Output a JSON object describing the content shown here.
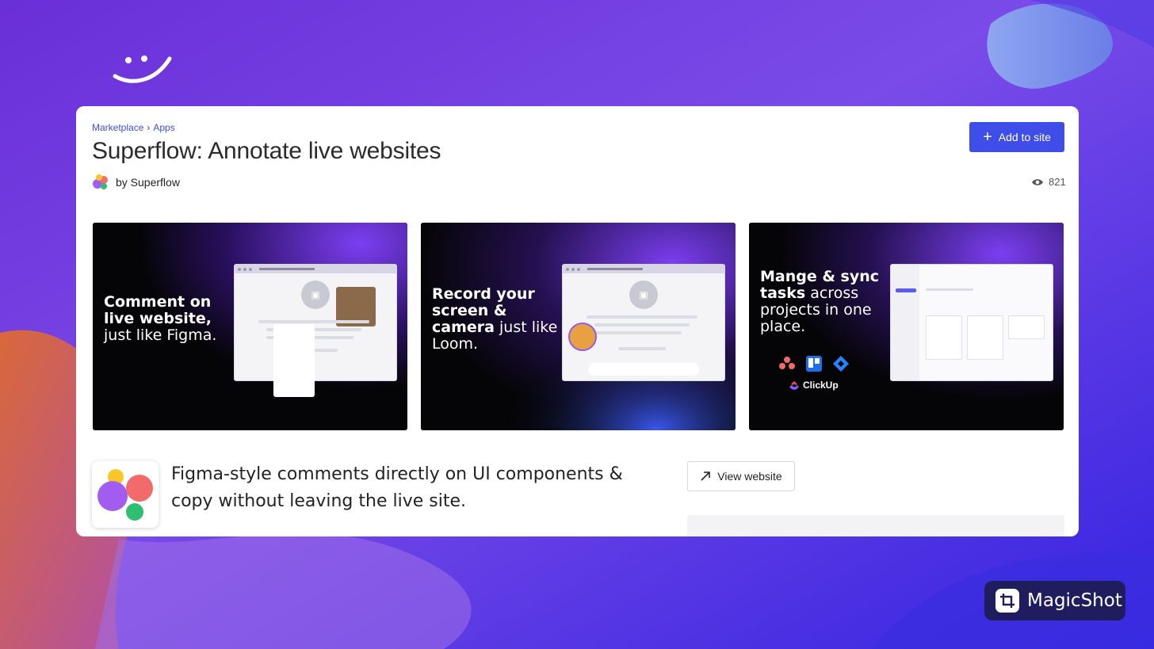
{
  "colors": {
    "accent": "#3f4ee8",
    "background": "#5b33e6",
    "badge": "#1f1d5e"
  },
  "breadcrumb": {
    "items": [
      "Marketplace",
      "Apps"
    ],
    "separator": "›"
  },
  "app": {
    "title": "Superflow: Annotate live websites",
    "byline": "by Superflow",
    "views": "821",
    "add_label": "Add to site",
    "view_website_label": "View website",
    "description": "Figma-style comments directly on UI components & copy without leaving the live site."
  },
  "screenshots": [
    {
      "heading_bold": "Comment on live website,",
      "heading_rest": "just like Figma."
    },
    {
      "heading_bold": "Record your screen & camera",
      "heading_rest": "just like Loom."
    },
    {
      "heading_bold": "Mange & sync tasks",
      "heading_rest": "across projects in one place.",
      "integration": "ClickUp"
    }
  ],
  "watermark": {
    "label": "MagicShot"
  },
  "icons": [
    "smiley-logo-icon",
    "superflow-logo-icon",
    "plus-icon",
    "eye-icon",
    "arrow-up-right-icon",
    "crop-icon",
    "asana-icon",
    "trello-icon",
    "jira-icon",
    "clickup-icon"
  ]
}
